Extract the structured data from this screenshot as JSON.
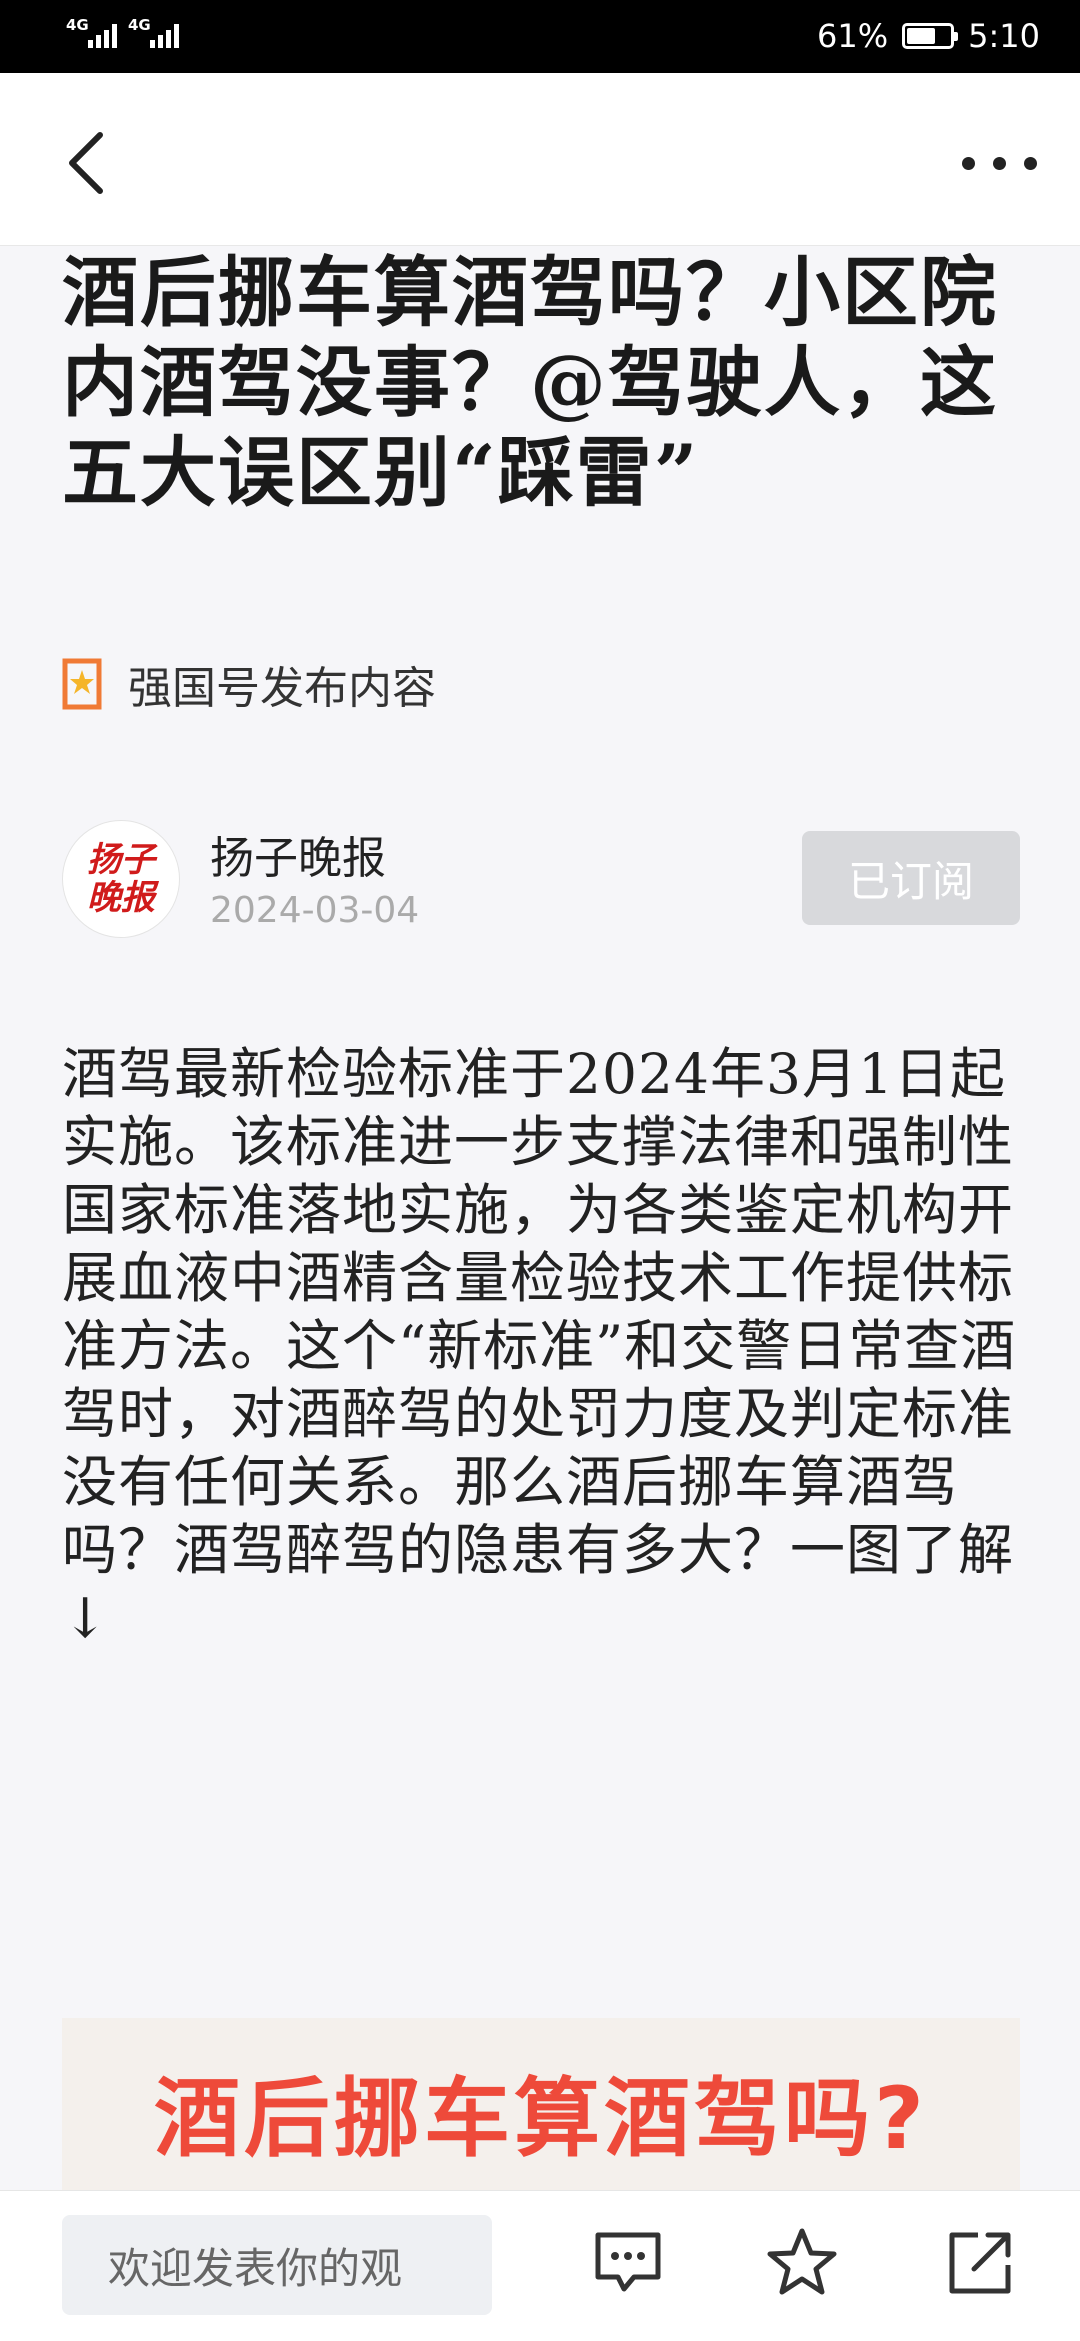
{
  "status_bar": {
    "signal1_label": "4G",
    "signal2_label": "4G",
    "battery_percent": "61%",
    "battery_level": 0.61,
    "time": "5:10"
  },
  "nav": {
    "back_icon": "chevron-left-icon",
    "more_icon": "more-horizontal-icon"
  },
  "article": {
    "title": "酒后挪车算酒驾吗？小区院内酒驾没事？@驾驶人，这五大误区别“踩雷”",
    "source_tag": "强国号发布内容",
    "source_tag_icon": "bookmark-star-icon",
    "source_tag_color": "#f07a35",
    "author": {
      "logo_text": "扬子晚报",
      "name": "扬子晚报",
      "date": "2024-03-04",
      "subscribe_label": "已订阅"
    },
    "body": "酒驾最新检验标准于2024年3月1日起实施。该标准进一步支撑法律和强制性国家标准落地实施，为各类鉴定机构开展血液中酒精含量检验技术工作提供标准方法。这个“新标准”和交警日常查酒驾时，对酒醉驾的处罚力度及判定标准没有任何关系。那么酒后挪车算酒驾吗？酒驾醉驾的隐患有多大？一图了解↓",
    "image_title": "酒后挪车算酒驾吗?",
    "image_title_color": "#ee4a3a"
  },
  "bottom_bar": {
    "comment_placeholder": "欢迎发表你的观",
    "comment_icon": "comment-icon",
    "favorite_icon": "star-icon",
    "share_icon": "share-icon"
  }
}
